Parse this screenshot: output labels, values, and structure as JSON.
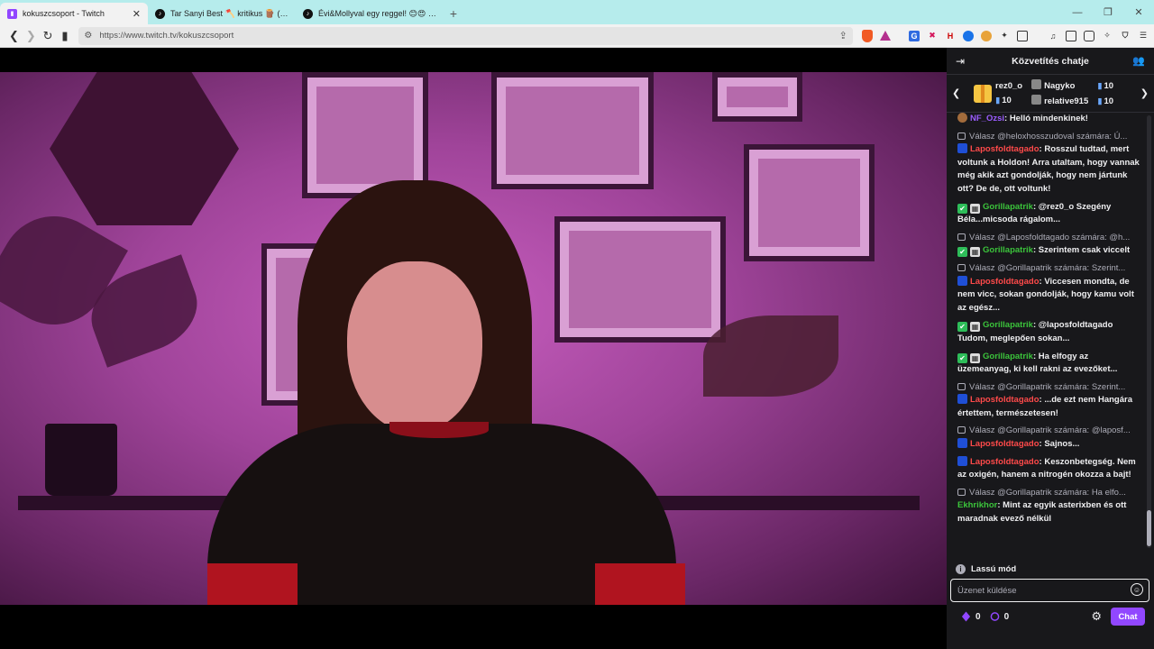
{
  "browser": {
    "tabs": [
      {
        "label": "kokuszcsoport - Twitch",
        "active": true,
        "icon": "twitch-icon"
      },
      {
        "label": "Tar Sanyi Best 🪓 kritikus 🪵 (@szop",
        "active": false,
        "icon": "tiktok-icon"
      },
      {
        "label": "Évi&Mollyval egy reggel! 😊😍 (@m",
        "active": false,
        "icon": "tiktok-icon"
      }
    ],
    "url": "https://www.twitch.tv/kokuszcsoport"
  },
  "chat": {
    "header_title": "Közvetítés chatje",
    "leaderboard": {
      "top_name": "rez0_o",
      "top_count": "10",
      "second_name": "Nagyko",
      "second_count": "10",
      "third_name": "relative915",
      "third_count": "10"
    },
    "messages": [
      {
        "user": "NF_Ozsi",
        "color": "#9b5cff",
        "text": ": Helló mindenkinek!"
      },
      {
        "reply": "Válasz @heloxhosszudoval számára: Ú...",
        "user": "Laposfoldtagado",
        "color": "#ff4a4a",
        "text": ": Rosszul tudtad, mert voltunk a Holdon! Arra utaltam, hogy vannak még akik azt gondolják, hogy nem jártunk ott? De de, ott voltunk!"
      },
      {
        "user": "Gorillapatrik",
        "color": "#3bc43b",
        "text": ": @rez0_o Szegény Béla...micsoda rágalom..."
      },
      {
        "reply": "Válasz @Laposfoldtagado számára: @h...",
        "user": "Gorillapatrik",
        "color": "#3bc43b",
        "text": ": Szerintem csak viccelt"
      },
      {
        "reply": "Válasz @Gorillapatrik számára: Szerint...",
        "user": "Laposfoldtagado",
        "color": "#ff4a4a",
        "text": ": Viccesen mondta, de nem vicc, sokan gondolják, hogy kamu volt az egész..."
      },
      {
        "user": "Gorillapatrik",
        "color": "#3bc43b",
        "text": ": @laposfoldtagado Tudom, meglepően sokan..."
      },
      {
        "user": "Gorillapatrik",
        "color": "#3bc43b",
        "text": ": Ha elfogy az üzemeanyag, ki kell rakni az evezőket..."
      },
      {
        "reply": "Válasz @Gorillapatrik számára: Szerint...",
        "user": "Laposfoldtagado",
        "color": "#ff4a4a",
        "text": ": ...de ezt nem Hangára értettem, természetesen!"
      },
      {
        "reply": "Válasz @Gorillapatrik számára: @laposf...",
        "user": "Laposfoldtagado",
        "color": "#ff4a4a",
        "text": ": Sajnos..."
      },
      {
        "user": "Laposfoldtagado",
        "color": "#ff4a4a",
        "text": ": Keszonbetegség. Nem az oxigén, hanem a nitrogén okozza a bajt!"
      },
      {
        "reply": "Válasz @Gorillapatrik számára: Ha elfo...",
        "user": "Ekhrikhor",
        "color": "#3bc43b",
        "text": ": Mint az egyik asterixben és ott maradnak evező nélkül"
      }
    ],
    "slow_mode": "Lassú mód",
    "input_placeholder": "Üzenet küldése",
    "points_a": "0",
    "points_b": "0",
    "send_label": "Chat"
  }
}
